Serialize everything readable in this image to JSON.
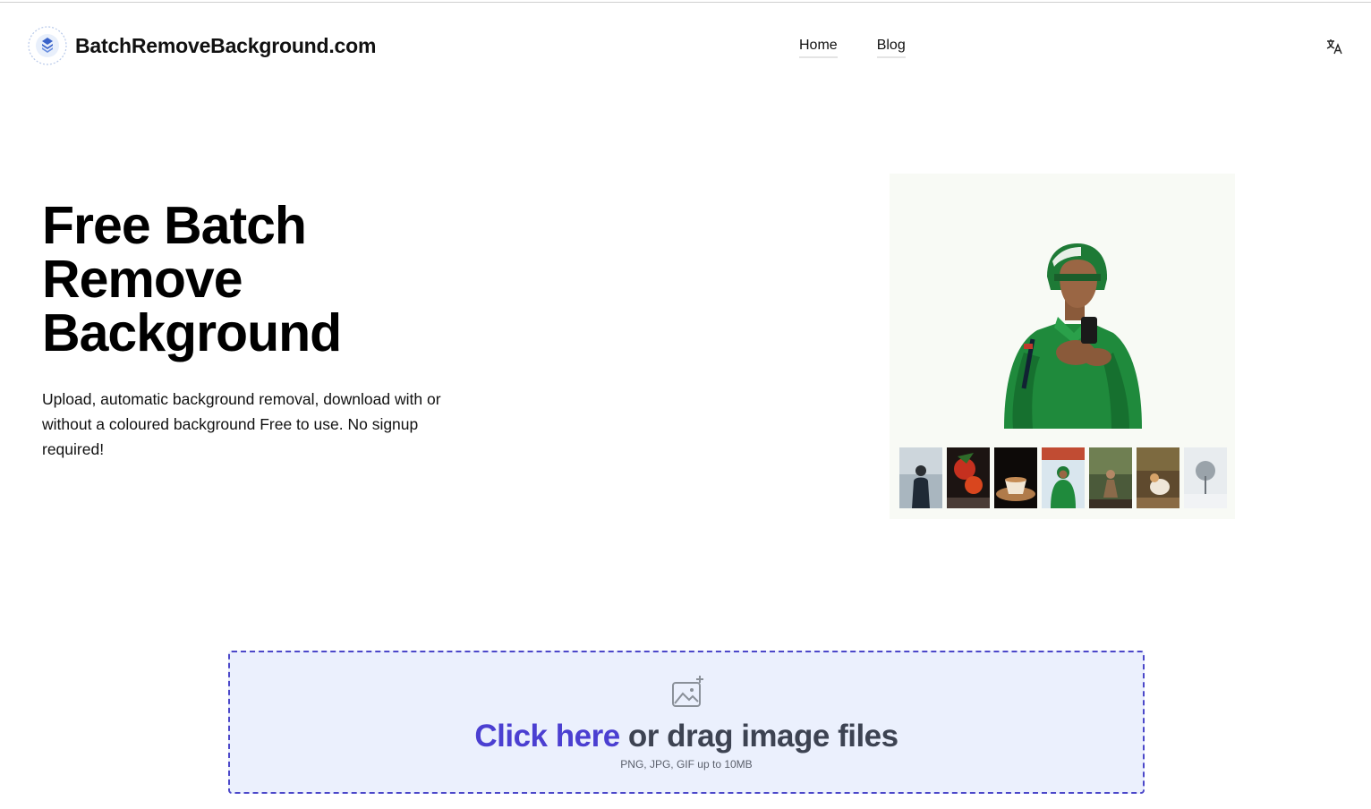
{
  "header": {
    "brand_name": "BatchRemoveBackground.com",
    "logo_icon": "layers-icon",
    "nav": [
      {
        "label": "Home"
      },
      {
        "label": "Blog"
      }
    ],
    "language_icon": "translate-icon"
  },
  "hero": {
    "title_lines": [
      "Free Batch",
      "Remove",
      "Background"
    ],
    "description": "Upload, automatic background removal, download with or without a coloured background Free to use. No signup required!"
  },
  "showcase": {
    "thumbnails": [
      "thumb-person-snow",
      "thumb-fruit",
      "thumb-coffee",
      "thumb-rider",
      "thumb-woman-forest",
      "thumb-dog",
      "thumb-tree-snow"
    ],
    "active_index": 3
  },
  "upload": {
    "click_label": "Click here",
    "drag_label": "or drag image files",
    "hint": "PNG, JPG, GIF up to 10MB",
    "icon": "add-image-icon"
  },
  "colors": {
    "accent": "#4b3fd1",
    "dropzone_bg": "#ebf0fd",
    "dropzone_border": "#4b47c9"
  }
}
